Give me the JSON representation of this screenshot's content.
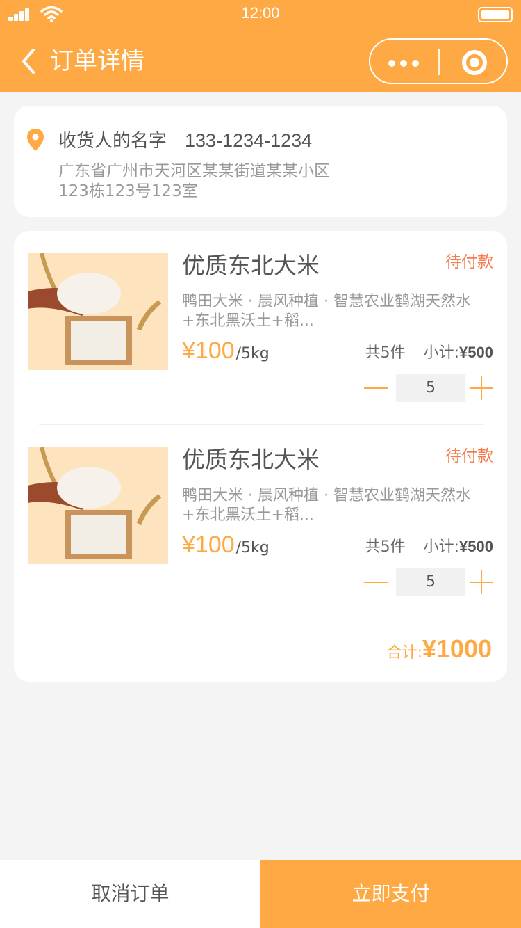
{
  "status_bar": {
    "time": "12:00"
  },
  "nav": {
    "title": "订单详情",
    "icons": [
      "back-arrow-icon",
      "more-dots-icon",
      "target-icon"
    ]
  },
  "address": {
    "receiver": "收货人的名字",
    "phone": "133-1234-1234",
    "line1": "广东省广州市天河区某某街道某某小区",
    "line2": "123栋123号123室",
    "icon": "location-pin-icon"
  },
  "order": {
    "items": [
      {
        "name": "优质东北大米",
        "status": "待付款",
        "desc1": "鸭田大米 · 晨风种植 · 智慧农业鹤湖天然水",
        "desc2": "+东北黑沃土+稻...",
        "price": "¥100",
        "unit": "/5kg",
        "count_text": "共5件",
        "subtotal_label": "小计:",
        "subtotal": "¥500",
        "quantity": "5"
      },
      {
        "name": "优质东北大米",
        "status": "待付款",
        "desc1": "鸭田大米 · 晨风种植 · 智慧农业鹤湖天然水",
        "desc2": "+东北黑沃土+稻...",
        "price": "¥100",
        "unit": "/5kg",
        "count_text": "共5件",
        "subtotal_label": "小计:",
        "subtotal": "¥500",
        "quantity": "5"
      }
    ],
    "total_label": "合计:",
    "total": "¥1000"
  },
  "actions": {
    "cancel": "取消订单",
    "pay": "立即支付"
  },
  "colors": {
    "accent": "#fea944",
    "status": "#f47c4f",
    "background": "#f4f4f4"
  }
}
